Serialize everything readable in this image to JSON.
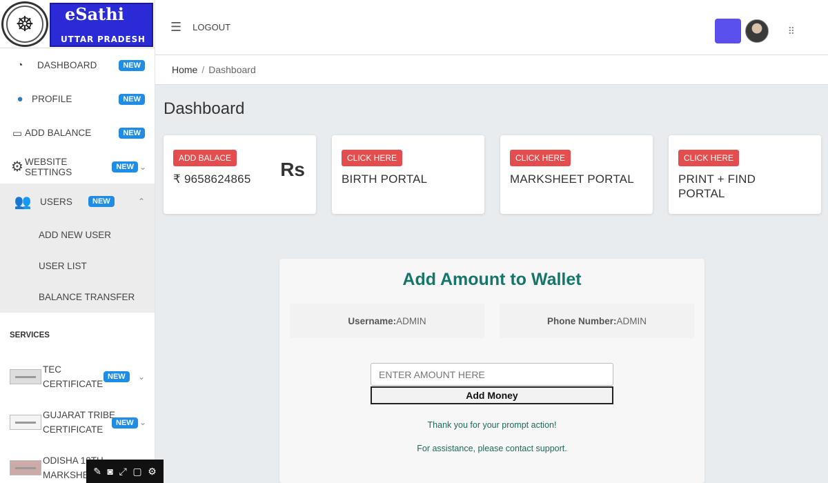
{
  "brand": {
    "title": "eSathi",
    "subtitle": "UTTAR PRADESH",
    "emblem_icon": "up-emblem-icon"
  },
  "header": {
    "logout_label": "LOGOUT",
    "accent_color": "#5a50ec"
  },
  "breadcrumb": {
    "home": "Home",
    "separator": "/",
    "current": "Dashboard"
  },
  "page": {
    "title": "Dashboard"
  },
  "sidebar": {
    "badge": "NEW",
    "items": [
      {
        "label": "DASHBOARD",
        "icon": "dashboard-gauge-icon"
      },
      {
        "label": "PROFILE",
        "icon": "profile-icon"
      },
      {
        "label": "ADD BALANCE",
        "icon": "wallet-icon"
      },
      {
        "label": "WEBSITE SETTINGS",
        "icon": "gear-icon"
      },
      {
        "label": "USERS",
        "icon": "users-icon"
      }
    ],
    "users_submenu": [
      "ADD NEW USER",
      "USER LIST",
      "BALANCE TRANSFER"
    ],
    "services_heading": "SERVICES",
    "services": [
      {
        "line1": "TEC",
        "line2": "CERTIFICATE"
      },
      {
        "line1": "GUJARAT TRIBE",
        "line2": "CERTIFICATE"
      },
      {
        "line1": "ODISHA 10TH",
        "line2": "MARKSHE"
      }
    ]
  },
  "cards": [
    {
      "button": "ADD BALACE",
      "text": "₹ 9658624865",
      "symbol": "Rs"
    },
    {
      "button": "CLICK HERE",
      "text": "BIRTH PORTAL"
    },
    {
      "button": "CLICK HERE",
      "text": "MARKSHEET PORTAL"
    },
    {
      "button": "CLICK HERE",
      "text": "PRINT + FIND PORTAL"
    }
  ],
  "wallet": {
    "title": "Add Amount to Wallet",
    "username_label": "Username:",
    "username_value": " ADMIN",
    "phone_label": "Phone Number:",
    "phone_value": "ADMIN",
    "amount_placeholder": "ENTER AMOUNT HERE",
    "submit_label": "Add Money",
    "message1": "Thank you for your prompt action!",
    "message2": "For assistance, please contact support.",
    "title_color": "#16766a"
  },
  "colors": {
    "card_button": "#e34d4d",
    "badge": "#1f8ce6",
    "brand_blue": "#2a2ad6"
  }
}
